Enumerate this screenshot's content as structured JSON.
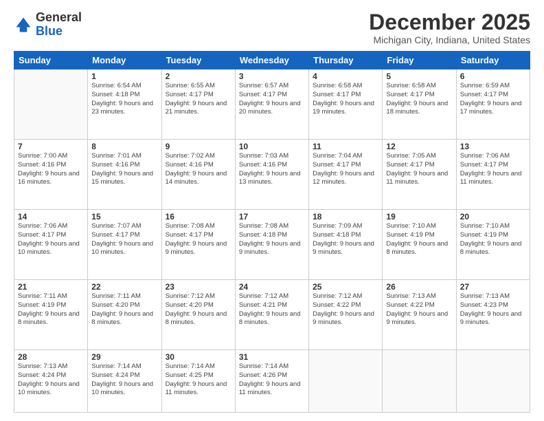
{
  "logo": {
    "general": "General",
    "blue": "Blue"
  },
  "header": {
    "title": "December 2025",
    "subtitle": "Michigan City, Indiana, United States"
  },
  "weekdays": [
    "Sunday",
    "Monday",
    "Tuesday",
    "Wednesday",
    "Thursday",
    "Friday",
    "Saturday"
  ],
  "weeks": [
    [
      {
        "day": "",
        "empty": true
      },
      {
        "day": "1",
        "sunrise": "6:54 AM",
        "sunset": "4:18 PM",
        "daylight": "9 hours and 23 minutes."
      },
      {
        "day": "2",
        "sunrise": "6:55 AM",
        "sunset": "4:17 PM",
        "daylight": "9 hours and 21 minutes."
      },
      {
        "day": "3",
        "sunrise": "6:57 AM",
        "sunset": "4:17 PM",
        "daylight": "9 hours and 20 minutes."
      },
      {
        "day": "4",
        "sunrise": "6:58 AM",
        "sunset": "4:17 PM",
        "daylight": "9 hours and 19 minutes."
      },
      {
        "day": "5",
        "sunrise": "6:58 AM",
        "sunset": "4:17 PM",
        "daylight": "9 hours and 18 minutes."
      },
      {
        "day": "6",
        "sunrise": "6:59 AM",
        "sunset": "4:17 PM",
        "daylight": "9 hours and 17 minutes."
      }
    ],
    [
      {
        "day": "7",
        "sunrise": "7:00 AM",
        "sunset": "4:16 PM",
        "daylight": "9 hours and 16 minutes."
      },
      {
        "day": "8",
        "sunrise": "7:01 AM",
        "sunset": "4:16 PM",
        "daylight": "9 hours and 15 minutes."
      },
      {
        "day": "9",
        "sunrise": "7:02 AM",
        "sunset": "4:16 PM",
        "daylight": "9 hours and 14 minutes."
      },
      {
        "day": "10",
        "sunrise": "7:03 AM",
        "sunset": "4:16 PM",
        "daylight": "9 hours and 13 minutes."
      },
      {
        "day": "11",
        "sunrise": "7:04 AM",
        "sunset": "4:17 PM",
        "daylight": "9 hours and 12 minutes."
      },
      {
        "day": "12",
        "sunrise": "7:05 AM",
        "sunset": "4:17 PM",
        "daylight": "9 hours and 11 minutes."
      },
      {
        "day": "13",
        "sunrise": "7:06 AM",
        "sunset": "4:17 PM",
        "daylight": "9 hours and 11 minutes."
      }
    ],
    [
      {
        "day": "14",
        "sunrise": "7:06 AM",
        "sunset": "4:17 PM",
        "daylight": "9 hours and 10 minutes."
      },
      {
        "day": "15",
        "sunrise": "7:07 AM",
        "sunset": "4:17 PM",
        "daylight": "9 hours and 10 minutes."
      },
      {
        "day": "16",
        "sunrise": "7:08 AM",
        "sunset": "4:17 PM",
        "daylight": "9 hours and 9 minutes."
      },
      {
        "day": "17",
        "sunrise": "7:08 AM",
        "sunset": "4:18 PM",
        "daylight": "9 hours and 9 minutes."
      },
      {
        "day": "18",
        "sunrise": "7:09 AM",
        "sunset": "4:18 PM",
        "daylight": "9 hours and 9 minutes."
      },
      {
        "day": "19",
        "sunrise": "7:10 AM",
        "sunset": "4:19 PM",
        "daylight": "9 hours and 8 minutes."
      },
      {
        "day": "20",
        "sunrise": "7:10 AM",
        "sunset": "4:19 PM",
        "daylight": "9 hours and 8 minutes."
      }
    ],
    [
      {
        "day": "21",
        "sunrise": "7:11 AM",
        "sunset": "4:19 PM",
        "daylight": "9 hours and 8 minutes."
      },
      {
        "day": "22",
        "sunrise": "7:11 AM",
        "sunset": "4:20 PM",
        "daylight": "9 hours and 8 minutes."
      },
      {
        "day": "23",
        "sunrise": "7:12 AM",
        "sunset": "4:20 PM",
        "daylight": "9 hours and 8 minutes."
      },
      {
        "day": "24",
        "sunrise": "7:12 AM",
        "sunset": "4:21 PM",
        "daylight": "9 hours and 8 minutes."
      },
      {
        "day": "25",
        "sunrise": "7:12 AM",
        "sunset": "4:22 PM",
        "daylight": "9 hours and 9 minutes."
      },
      {
        "day": "26",
        "sunrise": "7:13 AM",
        "sunset": "4:22 PM",
        "daylight": "9 hours and 9 minutes."
      },
      {
        "day": "27",
        "sunrise": "7:13 AM",
        "sunset": "4:23 PM",
        "daylight": "9 hours and 9 minutes."
      }
    ],
    [
      {
        "day": "28",
        "sunrise": "7:13 AM",
        "sunset": "4:24 PM",
        "daylight": "9 hours and 10 minutes."
      },
      {
        "day": "29",
        "sunrise": "7:14 AM",
        "sunset": "4:24 PM",
        "daylight": "9 hours and 10 minutes."
      },
      {
        "day": "30",
        "sunrise": "7:14 AM",
        "sunset": "4:25 PM",
        "daylight": "9 hours and 11 minutes."
      },
      {
        "day": "31",
        "sunrise": "7:14 AM",
        "sunset": "4:26 PM",
        "daylight": "9 hours and 11 minutes."
      },
      {
        "day": "",
        "empty": true
      },
      {
        "day": "",
        "empty": true
      },
      {
        "day": "",
        "empty": true
      }
    ]
  ],
  "labels": {
    "sunrise": "Sunrise:",
    "sunset": "Sunset:",
    "daylight": "Daylight:"
  }
}
